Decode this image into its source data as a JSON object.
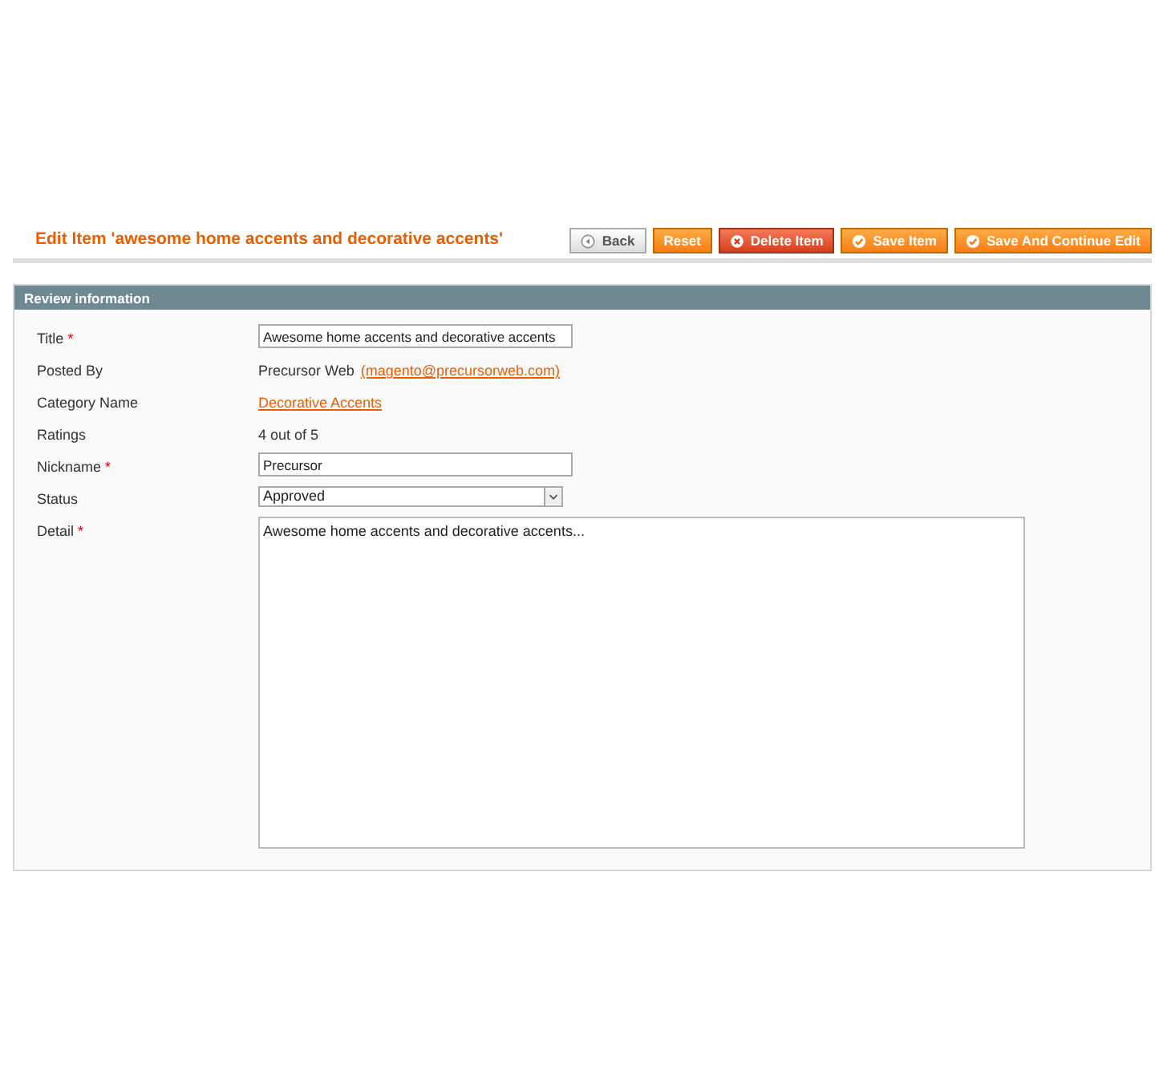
{
  "header": {
    "title": "Edit Item 'awesome home accents and decorative accents'"
  },
  "buttons": [
    {
      "label": "Back",
      "kind": "back"
    },
    {
      "label": "Reset",
      "kind": "plain"
    },
    {
      "label": "Delete Item",
      "kind": "delete"
    },
    {
      "label": "Save Item",
      "kind": "save"
    },
    {
      "label": "Save And Continue Edit",
      "kind": "save"
    }
  ],
  "section": {
    "title": "Review information"
  },
  "fields": [
    {
      "label": "Title",
      "mark": "*",
      "kind": "input",
      "value": "Awesome home accents and decorative accents"
    },
    {
      "label": "Posted By",
      "kind": "text",
      "value": "Precursor Web",
      "link": "(magento@precursorweb.com)"
    },
    {
      "label": "Category Name",
      "kind": "link",
      "link": "Decorative Accents"
    },
    {
      "label": "Ratings",
      "kind": "text",
      "value": "4 out of 5"
    },
    {
      "label": "Nickname",
      "mark": "*",
      "kind": "input",
      "value": "Precursor"
    },
    {
      "label": "Status",
      "kind": "select",
      "value": "Approved"
    },
    {
      "label": "Detail",
      "mark": "*",
      "kind": "textarea",
      "value": "Awesome home accents and decorative accents..."
    }
  ]
}
